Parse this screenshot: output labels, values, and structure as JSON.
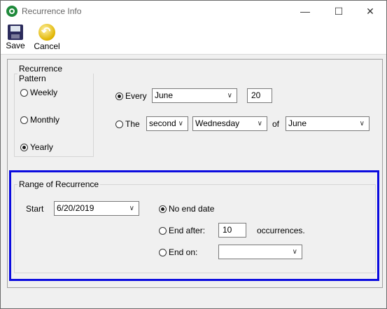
{
  "window": {
    "title": "Recurrence Info",
    "minimize": "—",
    "maximize": "☐",
    "close": "✕"
  },
  "toolbar": {
    "save_label": "Save",
    "cancel_label": "Cancel"
  },
  "pattern": {
    "legend": "Recurrence Pattern",
    "options": [
      "Weekly",
      "Monthly",
      "Yearly"
    ],
    "selected": "Yearly"
  },
  "yearly": {
    "every_label": "Every",
    "every_month": "June",
    "every_day": "20",
    "the_label": "The",
    "ordinal": "second",
    "weekday": "Wednesday",
    "of_label": "of",
    "of_month": "June",
    "selected": "Every"
  },
  "range": {
    "legend": "Range of Recurrence",
    "start_label": "Start",
    "start_date": "6/20/2019",
    "no_end_label": "No end date",
    "end_after_label": "End after:",
    "occurrences_value": "10",
    "occurrences_label": "occurrences.",
    "end_on_label": "End on:",
    "end_on_value": "",
    "selected": "No end date"
  },
  "colors": {
    "highlight": "#0b0bdf"
  }
}
